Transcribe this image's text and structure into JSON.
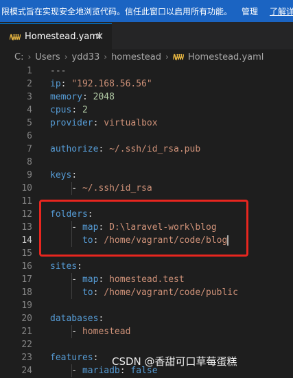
{
  "banner": {
    "message": "限模式旨在实现安全地浏览代码。信任此窗口以启用所有功能。",
    "manage": "管理",
    "learn_more": "了解详"
  },
  "tab": {
    "label": "Homestead.yaml",
    "close_glyph": "✕"
  },
  "breadcrumb": {
    "items": [
      "C:",
      "Users",
      "ydd33",
      "homestead"
    ],
    "separator": "›",
    "file": "Homestead.yaml"
  },
  "editor": {
    "current_line": 14,
    "lines": [
      {
        "n": "1",
        "tokens": [
          {
            "t": "---",
            "c": "punc"
          }
        ]
      },
      {
        "n": "2",
        "tokens": [
          {
            "t": "ip",
            "c": "key"
          },
          {
            "t": ": ",
            "c": "punc"
          },
          {
            "t": "\"192.168.56.56\"",
            "c": "str"
          }
        ]
      },
      {
        "n": "3",
        "tokens": [
          {
            "t": "memory",
            "c": "key"
          },
          {
            "t": ": ",
            "c": "punc"
          },
          {
            "t": "2048",
            "c": "num"
          }
        ]
      },
      {
        "n": "4",
        "tokens": [
          {
            "t": "cpus",
            "c": "key"
          },
          {
            "t": ": ",
            "c": "punc"
          },
          {
            "t": "2",
            "c": "num"
          }
        ]
      },
      {
        "n": "5",
        "tokens": [
          {
            "t": "provider",
            "c": "key"
          },
          {
            "t": ": ",
            "c": "punc"
          },
          {
            "t": "virtualbox",
            "c": "plain"
          }
        ]
      },
      {
        "n": "6",
        "tokens": []
      },
      {
        "n": "7",
        "tokens": [
          {
            "t": "authorize",
            "c": "key"
          },
          {
            "t": ": ",
            "c": "punc"
          },
          {
            "t": "~/.ssh/id_rsa.pub",
            "c": "plain"
          }
        ]
      },
      {
        "n": "8",
        "tokens": []
      },
      {
        "n": "9",
        "tokens": [
          {
            "t": "keys",
            "c": "key"
          },
          {
            "t": ":",
            "c": "punc"
          }
        ]
      },
      {
        "n": "10",
        "tokens": [
          {
            "t": "    - ",
            "c": "dash"
          },
          {
            "t": "~/.ssh/id_rsa",
            "c": "plain"
          }
        ]
      },
      {
        "n": "11",
        "tokens": []
      },
      {
        "n": "12",
        "tokens": [
          {
            "t": "folders",
            "c": "key"
          },
          {
            "t": ":",
            "c": "punc"
          }
        ]
      },
      {
        "n": "13",
        "tokens": [
          {
            "t": "    - ",
            "c": "dash"
          },
          {
            "t": "map",
            "c": "key"
          },
          {
            "t": ": ",
            "c": "punc"
          },
          {
            "t": "D:\\laravel-work\\blog",
            "c": "plain"
          }
        ]
      },
      {
        "n": "14",
        "tokens": [
          {
            "t": "      ",
            "c": "dash"
          },
          {
            "t": "to",
            "c": "key"
          },
          {
            "t": ": ",
            "c": "punc"
          },
          {
            "t": "/home/vagrant/code/blog",
            "c": "plain"
          }
        ]
      },
      {
        "n": "15",
        "tokens": []
      },
      {
        "n": "16",
        "tokens": [
          {
            "t": "sites",
            "c": "key"
          },
          {
            "t": ":",
            "c": "punc"
          }
        ]
      },
      {
        "n": "17",
        "tokens": [
          {
            "t": "    - ",
            "c": "dash"
          },
          {
            "t": "map",
            "c": "key"
          },
          {
            "t": ": ",
            "c": "punc"
          },
          {
            "t": "homestead.test",
            "c": "plain"
          }
        ]
      },
      {
        "n": "18",
        "tokens": [
          {
            "t": "      ",
            "c": "dash"
          },
          {
            "t": "to",
            "c": "key"
          },
          {
            "t": ": ",
            "c": "punc"
          },
          {
            "t": "/home/vagrant/code/public",
            "c": "plain"
          }
        ]
      },
      {
        "n": "19",
        "tokens": []
      },
      {
        "n": "20",
        "tokens": [
          {
            "t": "databases",
            "c": "key"
          },
          {
            "t": ":",
            "c": "punc"
          }
        ]
      },
      {
        "n": "21",
        "tokens": [
          {
            "t": "    - ",
            "c": "dash"
          },
          {
            "t": "homestead",
            "c": "plain"
          }
        ]
      },
      {
        "n": "22",
        "tokens": []
      },
      {
        "n": "23",
        "tokens": [
          {
            "t": "features",
            "c": "key"
          },
          {
            "t": ":",
            "c": "punc"
          }
        ]
      },
      {
        "n": "24",
        "tokens": [
          {
            "t": "    - ",
            "c": "dash"
          },
          {
            "t": "mariadb",
            "c": "key"
          },
          {
            "t": ": ",
            "c": "punc"
          },
          {
            "t": "false",
            "c": "bool"
          }
        ]
      }
    ]
  },
  "watermark": "CSDN @香甜可口草莓蛋糕",
  "colors": {
    "banner_bg": "#1b64c2",
    "editor_bg": "#1e1e1e",
    "key": "#569cd6",
    "string": "#ce9178",
    "number": "#b5cea8",
    "highlight_box": "#e8261f"
  }
}
